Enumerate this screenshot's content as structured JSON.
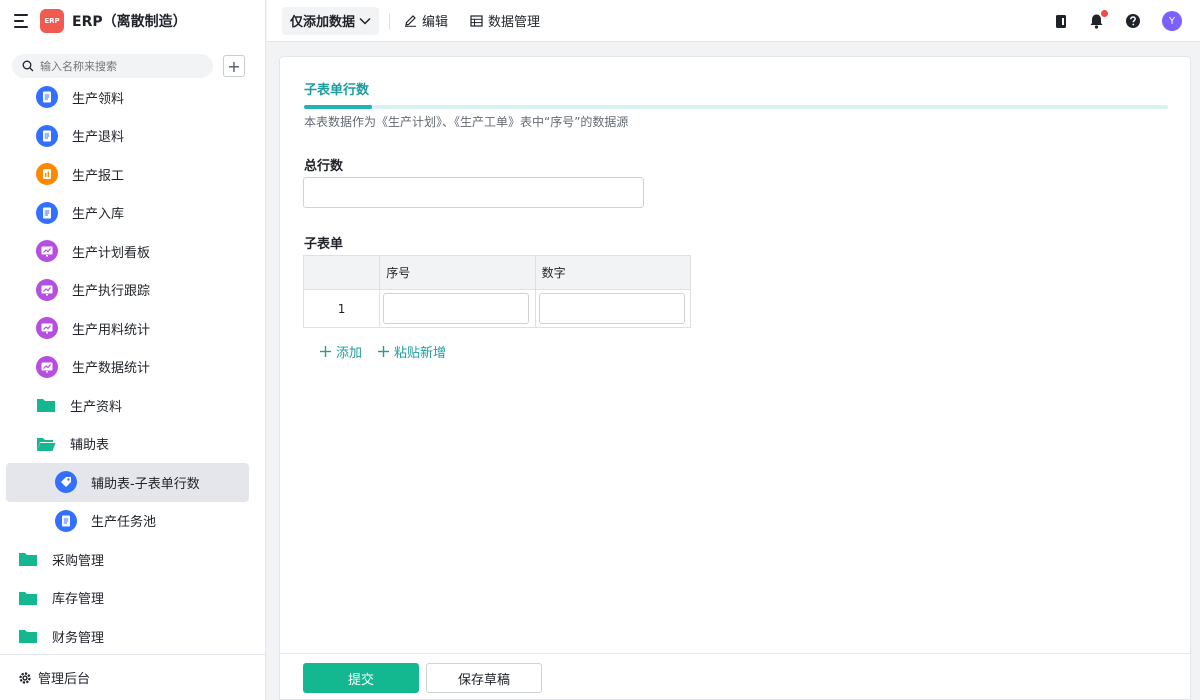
{
  "app": {
    "title": "ERP（离散制造）",
    "logo_text": "ERP"
  },
  "search": {
    "placeholder": "输入名称来搜索"
  },
  "sidebar": {
    "items": [
      {
        "label": "生产领料",
        "icon": "document-icon",
        "color": "#3370ff",
        "level": 1
      },
      {
        "label": "生产退料",
        "icon": "document-icon",
        "color": "#3370ff",
        "level": 1
      },
      {
        "label": "生产报工",
        "icon": "report-icon",
        "color": "#ff8800",
        "level": 1
      },
      {
        "label": "生产入库",
        "icon": "document-icon",
        "color": "#3370ff",
        "level": 1
      },
      {
        "label": "生产计划看板",
        "icon": "dashboard-icon",
        "color": "#b64fe0",
        "level": 1
      },
      {
        "label": "生产执行跟踪",
        "icon": "dashboard-icon",
        "color": "#b64fe0",
        "level": 1
      },
      {
        "label": "生产用料统计",
        "icon": "dashboard-icon",
        "color": "#b64fe0",
        "level": 1
      },
      {
        "label": "生产数据统计",
        "icon": "dashboard-icon",
        "color": "#b64fe0",
        "level": 1
      },
      {
        "label": "生产资料",
        "icon": "folder-icon",
        "color": "#14b890",
        "level": 1
      },
      {
        "label": "辅助表",
        "icon": "folder-open-icon",
        "color": "#14b890",
        "level": 1
      },
      {
        "label": "辅助表-子表单行数",
        "icon": "tag-icon",
        "color": "#3370ff",
        "level": 2,
        "active": true
      },
      {
        "label": "生产任务池",
        "icon": "document-icon",
        "color": "#3370ff",
        "level": 2
      },
      {
        "label": "采购管理",
        "icon": "folder-icon",
        "color": "#14b890",
        "level": 0
      },
      {
        "label": "库存管理",
        "icon": "folder-icon",
        "color": "#14b890",
        "level": 0
      },
      {
        "label": "财务管理",
        "icon": "folder-icon",
        "color": "#14b890",
        "level": 0
      }
    ],
    "footer_label": "管理后台"
  },
  "toolbar": {
    "mode_label": "仅添加数据",
    "edit_label": "编辑",
    "data_manage_label": "数据管理",
    "avatar_initial": "Y"
  },
  "form": {
    "tab_title": "子表单行数",
    "description": "本表数据作为《生产计划》、《生产工单》表中“序号”的数据源",
    "total_rows_label": "总行数",
    "total_rows_value": "",
    "subform_label": "子表单",
    "columns": [
      "序号",
      "数字"
    ],
    "rows": [
      {
        "index": "1",
        "serial": "",
        "number": ""
      }
    ],
    "add_label": "添加",
    "paste_add_label": "粘贴新增",
    "submit_label": "提交",
    "save_draft_label": "保存草稿"
  },
  "colors": {
    "accent": "#14b890",
    "tab_accent": "#1fb2b6",
    "link": "#1e9ca0",
    "badge": "#f54a45"
  }
}
